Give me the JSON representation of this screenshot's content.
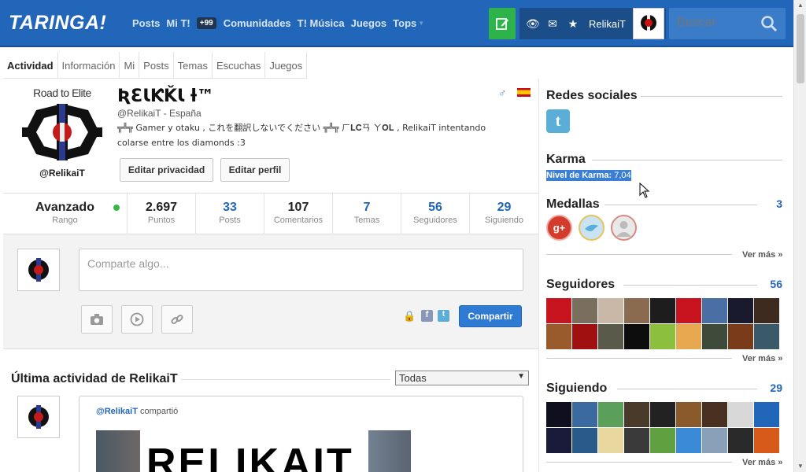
{
  "header": {
    "logo": "TARINGA!",
    "nav": [
      "Posts",
      "Mi T!",
      "Comunidades",
      "T! Música",
      "Juegos",
      "Tops"
    ],
    "badge": "+99",
    "username": "RelikaiT",
    "search_placeholder": "Buscar"
  },
  "tabs": [
    "Actividad",
    "Información",
    "Mi",
    "Posts",
    "Temas",
    "Escuchas",
    "Juegos"
  ],
  "profile": {
    "avatar_top": "Road to Elite",
    "avatar_bottom": "@RelikaiT",
    "name": "ƦƐƖƘǨƖ ƚ™",
    "handle": "@RelikaiT - España",
    "bio": "╦╩╦ Gamer y otaku , これを翻訳しないでください ╦╩╦ ㄏ𝐋𝐂ㄢ ㄚ𝐎𝐋 , RelikaiT intentando colarse entre los diamonds :3",
    "btn_privacy": "Editar privacidad",
    "btn_profile": "Editar perfil"
  },
  "stats": {
    "rank_value": "Avanzado",
    "rank_label": "Rango",
    "items": [
      {
        "value": "2.697",
        "label": "Puntos"
      },
      {
        "value": "33",
        "label": "Posts"
      },
      {
        "value": "107",
        "label": "Comentarios"
      },
      {
        "value": "7",
        "label": "Temas"
      },
      {
        "value": "56",
        "label": "Seguidores"
      },
      {
        "value": "29",
        "label": "Siguiendo"
      }
    ]
  },
  "composer": {
    "placeholder": "Comparte algo...",
    "share": "Compartir"
  },
  "activity": {
    "title": "Última actividad de RelikaiT",
    "filter": "Todas",
    "user": "@RelikaiT",
    "action": "compartió",
    "image_text": "RELIKAIT"
  },
  "sidebar": {
    "social_title": "Redes sociales",
    "karma_title": "Karma",
    "karma_label": "Nivel de Karma:",
    "karma_value": "7,04",
    "medals_title": "Medallas",
    "medals_count": "3",
    "more": "Ver más »",
    "followers_title": "Seguidores",
    "followers_count": "56",
    "following_title": "Siguiendo",
    "following_count": "29"
  },
  "colors": {
    "header": "#2166b8",
    "accent": "#2166b8",
    "compose": "#2db34a"
  }
}
